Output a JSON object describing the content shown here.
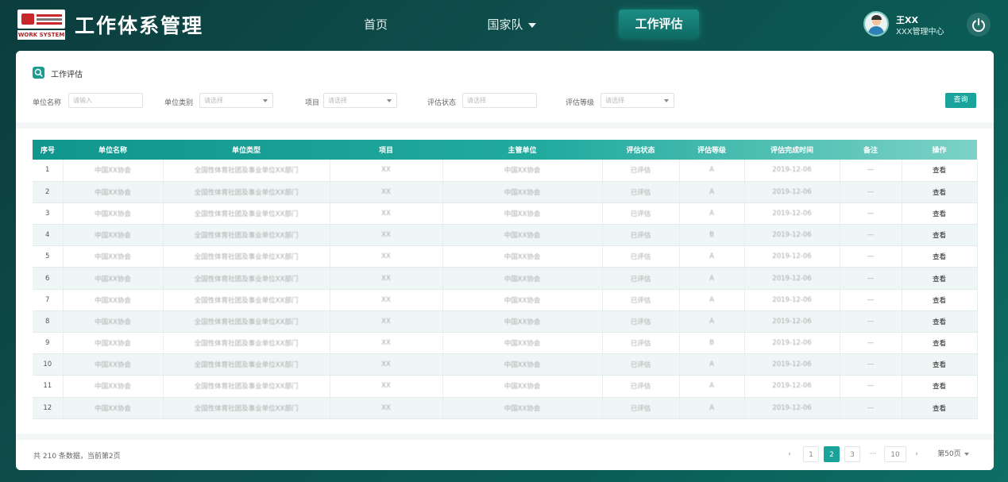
{
  "header": {
    "logo_text": "WORK SYSTEM",
    "app_title": "工作体系管理",
    "nav": [
      {
        "label": "首页"
      },
      {
        "label": "国家队"
      },
      {
        "label": "工作评估"
      }
    ],
    "user": {
      "name": "王XX",
      "org": "XXX管理中心"
    }
  },
  "filters": {
    "section_title": "工作评估",
    "fields": [
      {
        "label": "单位名称",
        "placeholder": "请输入"
      },
      {
        "label": "单位类别",
        "placeholder": "请选择"
      },
      {
        "label": "项目",
        "placeholder": "请选择"
      },
      {
        "label": "评估状态",
        "placeholder": "请选择"
      },
      {
        "label": "评估等级",
        "placeholder": "请选择"
      }
    ],
    "query_label": "查询"
  },
  "table": {
    "headers": [
      "序号",
      "单位名称",
      "单位类型",
      "项目",
      "主管单位",
      "评估状态",
      "评估等级",
      "评估完成时间",
      "备注",
      "操作"
    ],
    "rows": [
      {
        "idx": "1",
        "name": "中国XX协会",
        "type": "全国性体育社团及事业单位XX部门",
        "project": "XX",
        "owner": "中国XX协会",
        "status": "已评估",
        "grade": "A",
        "time": "2019-12-06",
        "note": "—",
        "op": "查看"
      },
      {
        "idx": "2",
        "name": "中国XX协会",
        "type": "全国性体育社团及事业单位XX部门",
        "project": "XX",
        "owner": "中国XX协会",
        "status": "已评估",
        "grade": "A",
        "time": "2019-12-06",
        "note": "—",
        "op": "查看"
      },
      {
        "idx": "3",
        "name": "中国XX协会",
        "type": "全国性体育社团及事业单位XX部门",
        "project": "XX",
        "owner": "中国XX协会",
        "status": "已评估",
        "grade": "A",
        "time": "2019-12-06",
        "note": "—",
        "op": "查看"
      },
      {
        "idx": "4",
        "name": "中国XX协会",
        "type": "全国性体育社团及事业单位XX部门",
        "project": "XX",
        "owner": "中国XX协会",
        "status": "已评估",
        "grade": "B",
        "time": "2019-12-06",
        "note": "—",
        "op": "查看"
      },
      {
        "idx": "5",
        "name": "中国XX协会",
        "type": "全国性体育社团及事业单位XX部门",
        "project": "XX",
        "owner": "中国XX协会",
        "status": "已评估",
        "grade": "A",
        "time": "2019-12-06",
        "note": "—",
        "op": "查看"
      },
      {
        "idx": "6",
        "name": "中国XX协会",
        "type": "全国性体育社团及事业单位XX部门",
        "project": "XX",
        "owner": "中国XX协会",
        "status": "已评估",
        "grade": "A",
        "time": "2019-12-06",
        "note": "—",
        "op": "查看"
      },
      {
        "idx": "7",
        "name": "中国XX协会",
        "type": "全国性体育社团及事业单位XX部门",
        "project": "XX",
        "owner": "中国XX协会",
        "status": "已评估",
        "grade": "A",
        "time": "2019-12-06",
        "note": "—",
        "op": "查看"
      },
      {
        "idx": "8",
        "name": "中国XX协会",
        "type": "全国性体育社团及事业单位XX部门",
        "project": "XX",
        "owner": "中国XX协会",
        "status": "已评估",
        "grade": "A",
        "time": "2019-12-06",
        "note": "—",
        "op": "查看"
      },
      {
        "idx": "9",
        "name": "中国XX协会",
        "type": "全国性体育社团及事业单位XX部门",
        "project": "XX",
        "owner": "中国XX协会",
        "status": "已评估",
        "grade": "B",
        "time": "2019-12-06",
        "note": "—",
        "op": "查看"
      },
      {
        "idx": "10",
        "name": "中国XX协会",
        "type": "全国性体育社团及事业单位XX部门",
        "project": "XX",
        "owner": "中国XX协会",
        "status": "已评估",
        "grade": "A",
        "time": "2019-12-06",
        "note": "—",
        "op": "查看"
      },
      {
        "idx": "11",
        "name": "中国XX协会",
        "type": "全国性体育社团及事业单位XX部门",
        "project": "XX",
        "owner": "中国XX协会",
        "status": "已评估",
        "grade": "A",
        "time": "2019-12-06",
        "note": "—",
        "op": "查看"
      },
      {
        "idx": "12",
        "name": "中国XX协会",
        "type": "全国性体育社团及事业单位XX部门",
        "project": "XX",
        "owner": "中国XX协会",
        "status": "已评估",
        "grade": "A",
        "time": "2019-12-06",
        "note": "—",
        "op": "查看"
      }
    ]
  },
  "pagination": {
    "summary": "共 210 条数据，当前第2页",
    "prev": "‹",
    "next": "›",
    "pages": [
      "1",
      "2",
      "3"
    ],
    "ellipsis": "···",
    "last": "10",
    "active_page": "2",
    "page_size": "第50页"
  },
  "icons": {
    "section": "search-icon",
    "power": "power-icon",
    "nav_dropdown": "chevron-down-icon"
  },
  "colors": {
    "accent": "#1aa39a",
    "header_bg": "#0b3d3d"
  }
}
